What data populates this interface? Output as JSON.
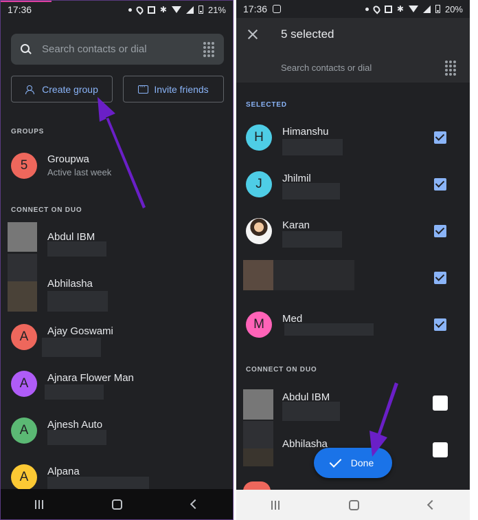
{
  "colors": {
    "background": "#202124",
    "accent": "#8ab4f8",
    "done_button": "#1a73e8",
    "annotation_arrow": "#6a1fc7"
  },
  "left": {
    "status": {
      "time": "17:36",
      "battery": "21%"
    },
    "search": {
      "placeholder": "Search contacts or dial"
    },
    "create_group_label": "Create group",
    "invite_friends_label": "Invite friends",
    "groups_label": "GROUPS",
    "group": {
      "initial": "5",
      "name": "Groupwa",
      "sub": "Active last week",
      "color": "#ee675c"
    },
    "connect_label": "CONNECT ON DUO",
    "contacts": [
      {
        "name": "Abdul IBM",
        "initial": "",
        "color": "#777777"
      },
      {
        "name": "Abhilasha",
        "initial": "",
        "color": "#4a4238"
      },
      {
        "name": "Ajay Goswami",
        "initial": "A",
        "color": "#ee675c"
      },
      {
        "name": "Ajnara Flower Man",
        "initial": "A",
        "color": "#af5cf7"
      },
      {
        "name": "Ajnesh Auto",
        "initial": "A",
        "color": "#5bb974"
      },
      {
        "name": "Alpana",
        "initial": "A",
        "color": "#fcc934"
      }
    ]
  },
  "right": {
    "status": {
      "time": "17:36",
      "battery": "20%"
    },
    "title": "5 selected",
    "search": {
      "placeholder": "Search contacts or dial"
    },
    "selected_label": "SELECTED",
    "selected": [
      {
        "name": "Himanshu",
        "initial": "H",
        "color": "#4ecde6",
        "checked": true
      },
      {
        "name": "Jhilmil",
        "initial": "J",
        "color": "#4ecde6",
        "checked": true
      },
      {
        "name": "Karan",
        "initial": "",
        "color": "#ffffff",
        "checked": true
      },
      {
        "name": "",
        "initial": "",
        "color": "#5a4a40",
        "checked": true
      },
      {
        "name": "Med",
        "initial": "M",
        "color": "#ff63b8",
        "checked": true
      }
    ],
    "connect_label": "CONNECT ON DUO",
    "connect": [
      {
        "name": "Abdul IBM",
        "checked": false
      },
      {
        "name": "Abhilasha",
        "checked": false
      }
    ],
    "done_label": "Done"
  }
}
